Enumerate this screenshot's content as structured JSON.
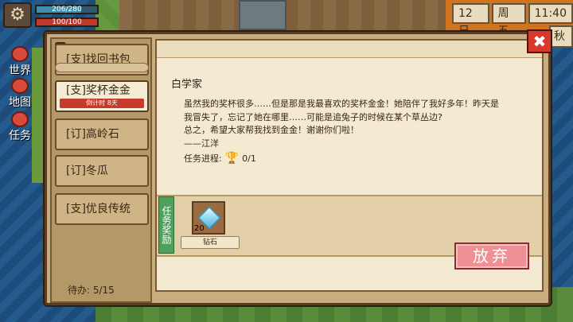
{
  "hud": {
    "hp": "206/280",
    "energy": "100/100",
    "day": "12日",
    "weekday": "周五",
    "time": "11:40",
    "season": "秋"
  },
  "side": {
    "world": "世界",
    "map": "地图",
    "task": "任务"
  },
  "quests": [
    {
      "label": "[支]找回书包"
    },
    {
      "label": "[支]奖杯金金",
      "timer": "倒计时 8天"
    },
    {
      "label": "[订]高岭石"
    },
    {
      "label": "[订]冬瓜"
    },
    {
      "label": "[支]优良传统"
    }
  ],
  "pending": "待办:   5/15",
  "detail": {
    "giver": "白学家",
    "lines": [
      "虽然我的奖杯很多……但是那是我最喜欢的奖杯金金！她陪伴了我好多年！昨天是",
      "我冒失了，忘记了她在哪里……可能是追兔子的时候在某个草丛边?",
      "总之，希望大家帮我找到金金！谢谢你们啦！",
      "——江洋"
    ],
    "progress_label": "任务进程:",
    "progress_value": "0/1"
  },
  "reward": {
    "section_label": "任务奖励",
    "item_count": "20",
    "item_name": "钻石"
  },
  "buttons": {
    "abandon": "放弃",
    "close": "✖"
  }
}
